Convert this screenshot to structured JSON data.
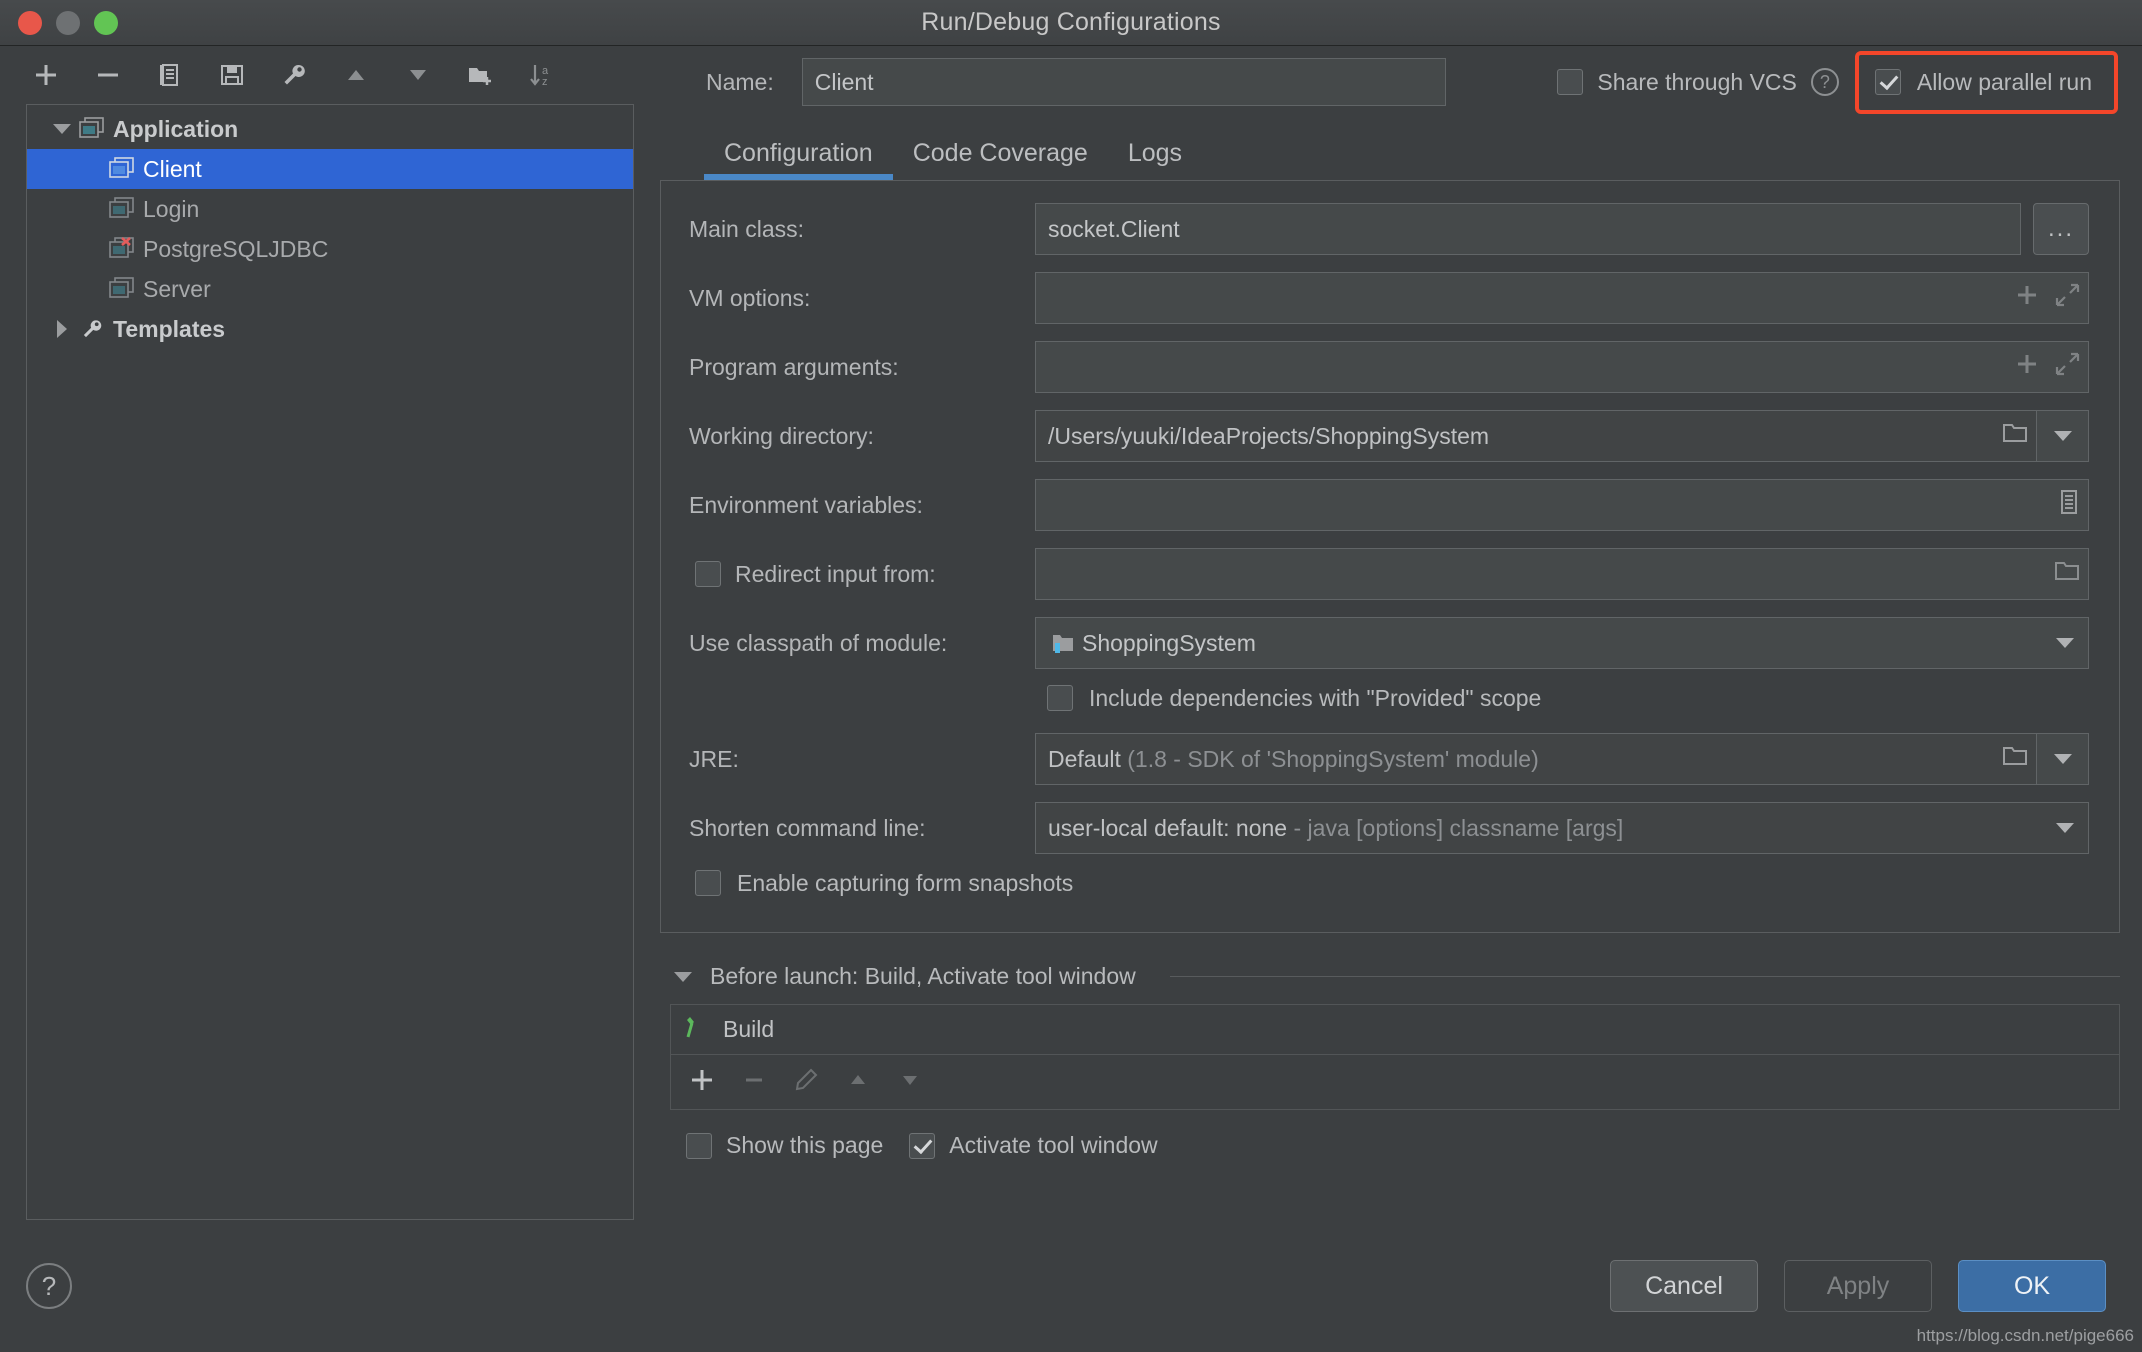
{
  "window": {
    "title": "Run/Debug Configurations",
    "traffic_lights": [
      "close",
      "minimize",
      "zoom"
    ]
  },
  "tree_toolbar": {
    "buttons": [
      {
        "name": "add-configuration-button",
        "icon": "plus-icon"
      },
      {
        "name": "remove-configuration-button",
        "icon": "minus-icon"
      },
      {
        "name": "copy-configuration-button",
        "icon": "copy-icon"
      },
      {
        "name": "save-configuration-button",
        "icon": "save-icon"
      },
      {
        "name": "edit-templates-button",
        "icon": "wrench-icon"
      },
      {
        "name": "move-up-button",
        "icon": "arrow-up-icon"
      },
      {
        "name": "move-down-button",
        "icon": "arrow-down-icon"
      },
      {
        "name": "new-folder-button",
        "icon": "folder-add-icon"
      },
      {
        "name": "sort-alphabetically-button",
        "icon": "sort-az-icon"
      }
    ]
  },
  "tree": {
    "nodes": [
      {
        "label": "Application",
        "icon": "application-icon",
        "twisty": "down",
        "depth": 0,
        "state": "group"
      },
      {
        "label": "Client",
        "icon": "application-icon",
        "twisty": "none",
        "depth": 1,
        "state": "selected"
      },
      {
        "label": "Login",
        "icon": "application-icon",
        "twisty": "none",
        "depth": 1,
        "state": "normal"
      },
      {
        "label": "PostgreSQLJDBC",
        "icon": "application-error-icon",
        "twisty": "none",
        "depth": 1,
        "state": "error"
      },
      {
        "label": "Server",
        "icon": "application-icon",
        "twisty": "none",
        "depth": 1,
        "state": "normal"
      },
      {
        "label": "Templates",
        "icon": "wrench-icon",
        "twisty": "right",
        "depth": 0,
        "state": "group"
      }
    ]
  },
  "header": {
    "name_label": "Name:",
    "name_value": "Client",
    "share_vcs_label": "Share through VCS",
    "share_vcs_checked": false,
    "share_vcs_help": "?",
    "allow_parallel_label": "Allow parallel run",
    "allow_parallel_checked": true,
    "highlight_color": "#f4462a"
  },
  "tabs": [
    {
      "label": "Configuration",
      "active": true
    },
    {
      "label": "Code Coverage",
      "active": false
    },
    {
      "label": "Logs",
      "active": false
    }
  ],
  "config": {
    "main_class": {
      "label": "Main class:",
      "value": "socket.Client",
      "browse": "..."
    },
    "vm_options": {
      "label": "VM options:",
      "value": "",
      "icons": [
        "plus-icon",
        "expand-icon"
      ]
    },
    "program_arguments": {
      "label": "Program arguments:",
      "value": "",
      "icons": [
        "plus-icon",
        "expand-icon"
      ]
    },
    "working_directory": {
      "label": "Working directory:",
      "value": "/Users/yuuki/IdeaProjects/ShoppingSystem",
      "icons": [
        "folder-icon"
      ]
    },
    "environment_variables": {
      "label": "Environment variables:",
      "value": "",
      "icons": [
        "list-icon"
      ]
    },
    "redirect_input": {
      "label": "Redirect input from:",
      "checked": false,
      "value": "",
      "icons": [
        "folder-icon"
      ]
    },
    "classpath_module": {
      "label": "Use classpath of module:",
      "value": "ShoppingSystem",
      "icon": "module-icon"
    },
    "include_provided": {
      "label": "Include dependencies with \"Provided\" scope",
      "checked": false
    },
    "jre": {
      "label": "JRE:",
      "value": "Default",
      "value_detail": "(1.8 - SDK of 'ShoppingSystem' module)",
      "icons": [
        "folder-icon"
      ]
    },
    "shorten_command_line": {
      "label": "Shorten command line:",
      "value": "user-local default: none",
      "value_detail": "- java [options] classname [args]"
    },
    "form_snapshots": {
      "label": "Enable capturing form snapshots",
      "checked": false
    }
  },
  "before_launch": {
    "header": "Before launch: Build, Activate tool window",
    "items": [
      {
        "label": "Build",
        "icon": "build-hammer-icon"
      }
    ],
    "toolbar": [
      {
        "name": "add-task-button",
        "icon": "plus-icon",
        "enabled": true
      },
      {
        "name": "remove-task-button",
        "icon": "minus-icon",
        "enabled": false
      },
      {
        "name": "edit-task-button",
        "icon": "pencil-icon",
        "enabled": false
      },
      {
        "name": "move-task-up-button",
        "icon": "arrow-up-icon",
        "enabled": false
      },
      {
        "name": "move-task-down-button",
        "icon": "arrow-down-icon",
        "enabled": false
      }
    ],
    "show_this_page": {
      "label": "Show this page",
      "checked": false
    },
    "activate_tool_window": {
      "label": "Activate tool window",
      "checked": true
    }
  },
  "footer": {
    "help": "?",
    "cancel": "Cancel",
    "apply": "Apply",
    "ok": "OK",
    "watermark": "https://blog.csdn.net/pige666"
  }
}
